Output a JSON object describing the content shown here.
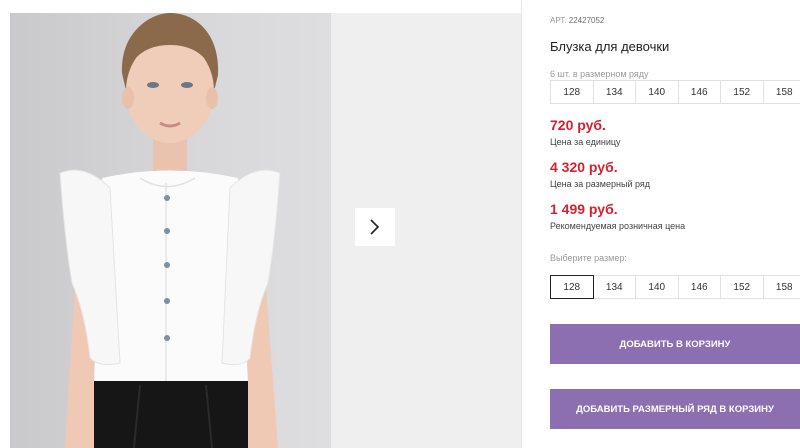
{
  "gallery": {
    "next_icon": "chevron-right-icon"
  },
  "product": {
    "article_label": "АРТ.",
    "article_number": "22427052",
    "title": "Блузка для девочки",
    "pack_note": "6 шт. в размерном ряду",
    "pack_sizes": [
      "128",
      "134",
      "140",
      "146",
      "152",
      "158"
    ]
  },
  "prices": [
    {
      "value": "720 руб.",
      "label": "Цена за единицу"
    },
    {
      "value": "4 320 руб.",
      "label": "Цена за размерный ряд"
    },
    {
      "value": "1 499 руб.",
      "label": "Рекомендуемая розничная цена"
    }
  ],
  "size_selector": {
    "label": "Выберите размер:",
    "sizes": [
      "128",
      "134",
      "140",
      "146",
      "152",
      "158"
    ],
    "selected": "128"
  },
  "actions": {
    "add_to_cart": "ДОБАВИТЬ В КОРЗИНУ",
    "add_row_to_cart": "ДОБАВИТЬ РАЗМЕРНЫЙ РЯД В КОРЗИНУ"
  },
  "colors": {
    "price": "#d22232",
    "button": "#8c6fb1"
  }
}
